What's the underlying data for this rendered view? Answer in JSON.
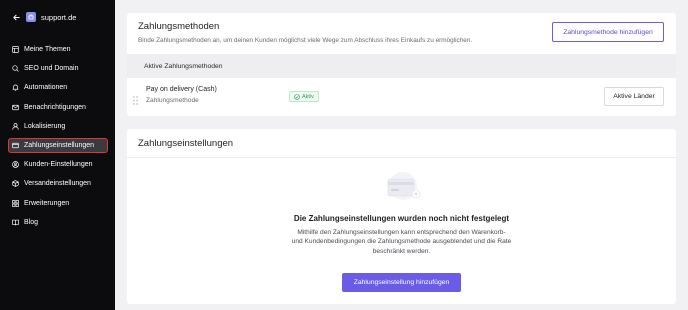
{
  "sidebar": {
    "brand": "support.de",
    "items": [
      {
        "label": "Meine Themen",
        "icon": "layout-icon"
      },
      {
        "label": "SEO und Domain",
        "icon": "search-icon"
      },
      {
        "label": "Automationen",
        "icon": "bell-icon"
      },
      {
        "label": "Benachrichtigungen",
        "icon": "mail-icon"
      },
      {
        "label": "Lokalisierung",
        "icon": "person-icon"
      },
      {
        "label": "Zahlungseinstellungen",
        "icon": "card-icon",
        "active": true
      },
      {
        "label": "Kunden-Einstellungen",
        "icon": "user-circle-icon"
      },
      {
        "label": "Versandeinstellungen",
        "icon": "package-icon"
      },
      {
        "label": "Erweiterungen",
        "icon": "grid-icon"
      },
      {
        "label": "Blog",
        "icon": "book-icon"
      }
    ]
  },
  "payment_methods": {
    "title": "Zahlungsmethoden",
    "subtitle": "Binde Zahlungsmethoden an, um deinen Kunden möglichst viele Wege zum Abschluss ihres Einkaufs zu ermöglichen.",
    "add_button": "Zahlungsmethode hinzufügen",
    "section_label": "Aktive Zahlungsmethoden",
    "rows": [
      {
        "name": "Pay on delivery (Cash)",
        "type": "Zahlungsmethode",
        "status": "Aktiv",
        "action": "Aktive Länder"
      }
    ]
  },
  "payment_settings": {
    "title": "Zahlungseinstellungen",
    "empty_title": "Die Zahlungseinstellungen wurden noch nicht festgelegt",
    "empty_desc": "Mithilfe den Zahlungseinstellungen kann entsprechend den Warenkorb- und Kundenbedingungen die Zahlungsmethode ausgeblendet und die Rate beschränkt werden.",
    "add_button": "Zahlungseinstellung hinzufügen"
  },
  "colors": {
    "accent": "#6b5ce7",
    "sidebar_bg": "#0c0c0e",
    "active_border": "#e0362e",
    "status_green": "#2e9a52"
  }
}
